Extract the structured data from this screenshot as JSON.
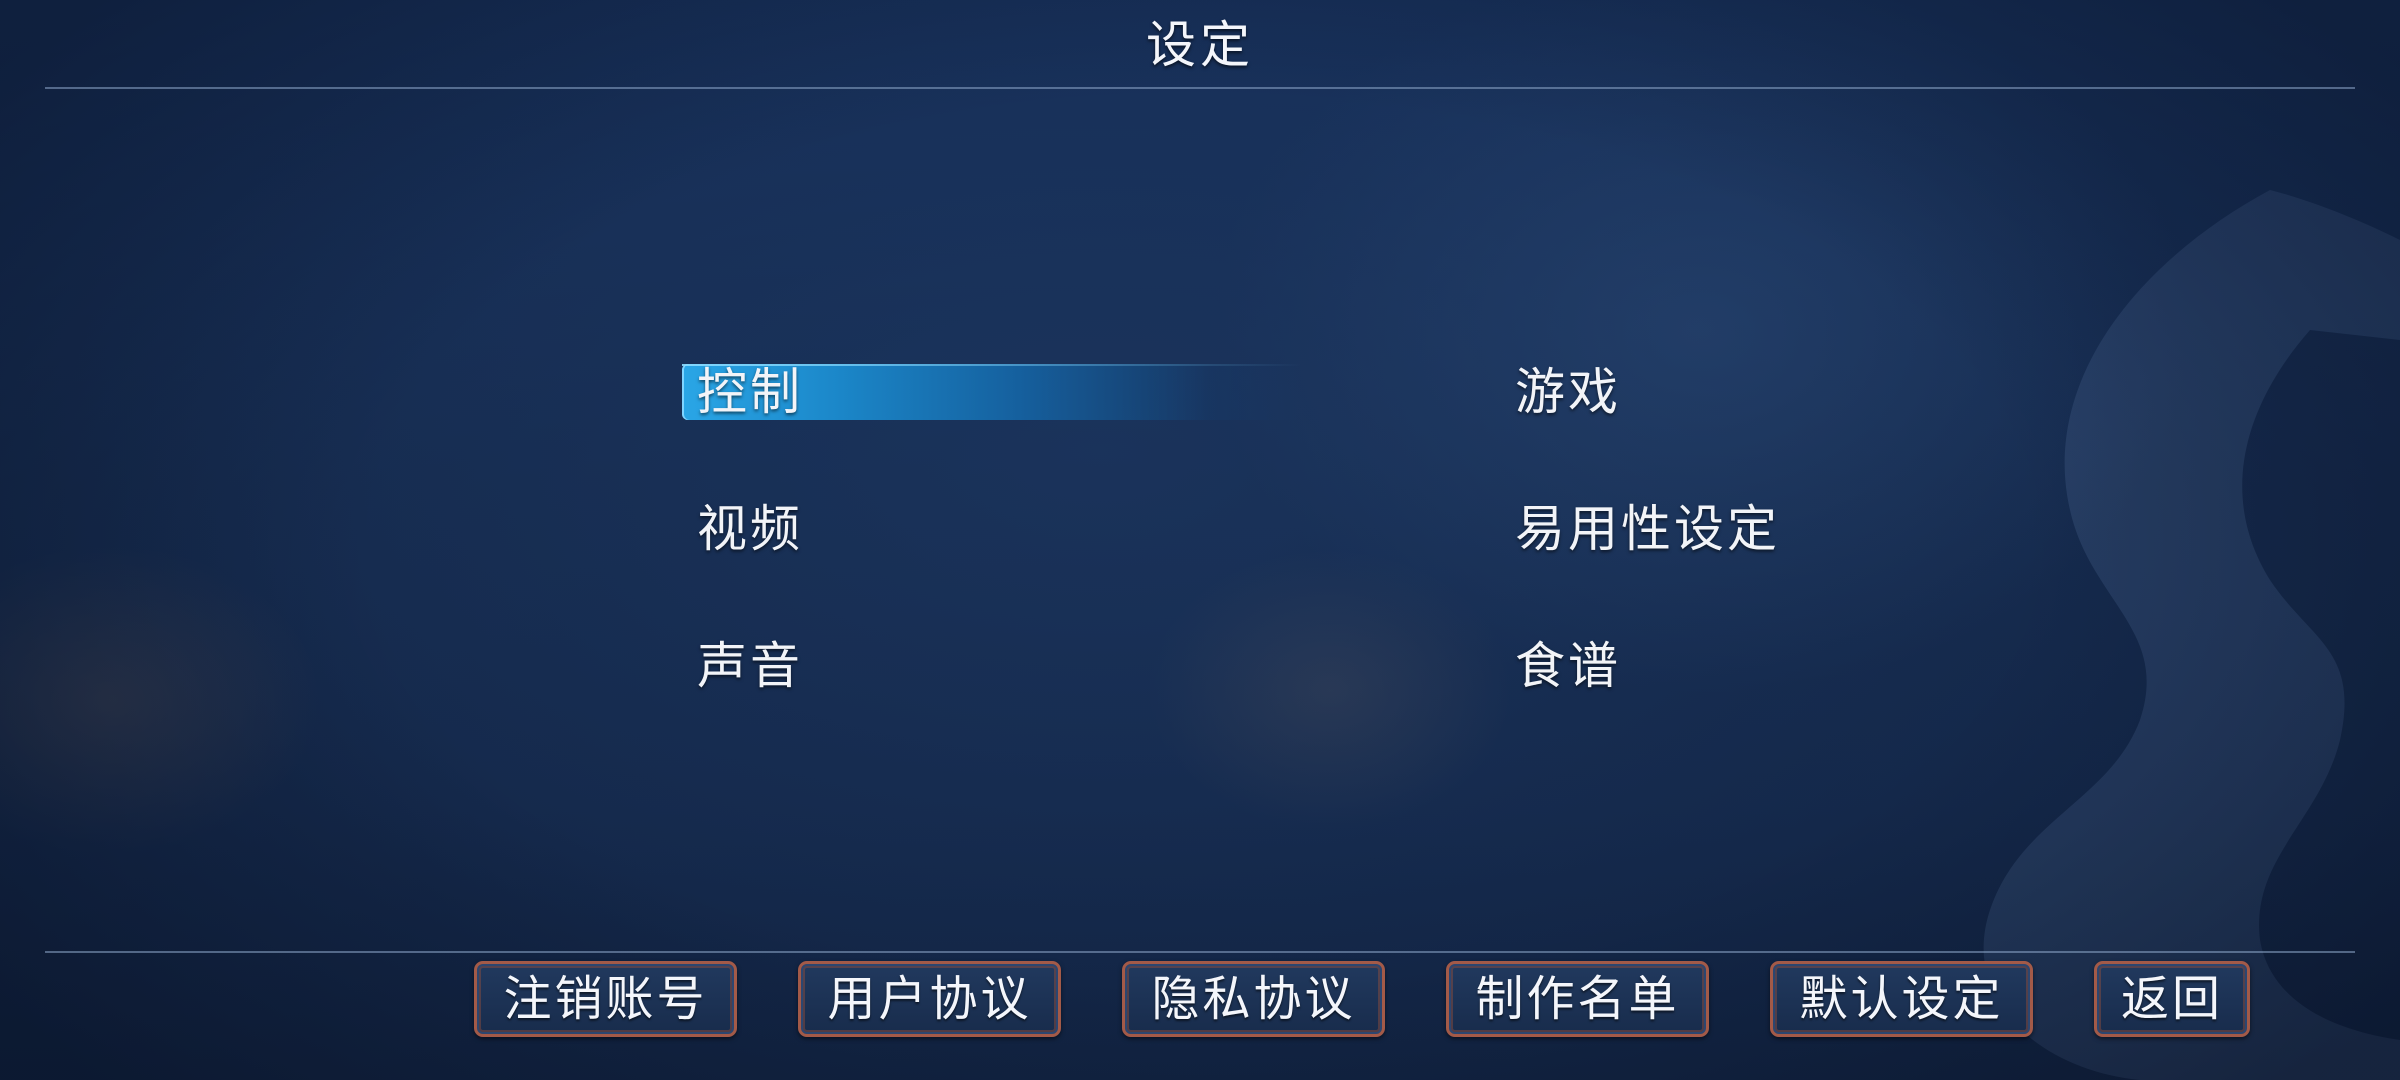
{
  "header": {
    "title": "设定"
  },
  "menu": {
    "left": [
      {
        "label": "控制",
        "selected": true
      },
      {
        "label": "视频",
        "selected": false
      },
      {
        "label": "声音",
        "selected": false
      }
    ],
    "right": [
      {
        "label": "游戏",
        "selected": false
      },
      {
        "label": "易用性设定",
        "selected": false
      },
      {
        "label": "食谱",
        "selected": false
      }
    ]
  },
  "footer": {
    "buttons": [
      {
        "label": "注销账号"
      },
      {
        "label": "用户协议"
      },
      {
        "label": "隐私协议"
      },
      {
        "label": "制作名单"
      },
      {
        "label": "默认设定"
      },
      {
        "label": "返回"
      }
    ]
  },
  "colors": {
    "background": "#16294a",
    "selection_highlight": "#2aa6e6",
    "button_border": "#a35a48",
    "text": "#ffffff"
  }
}
